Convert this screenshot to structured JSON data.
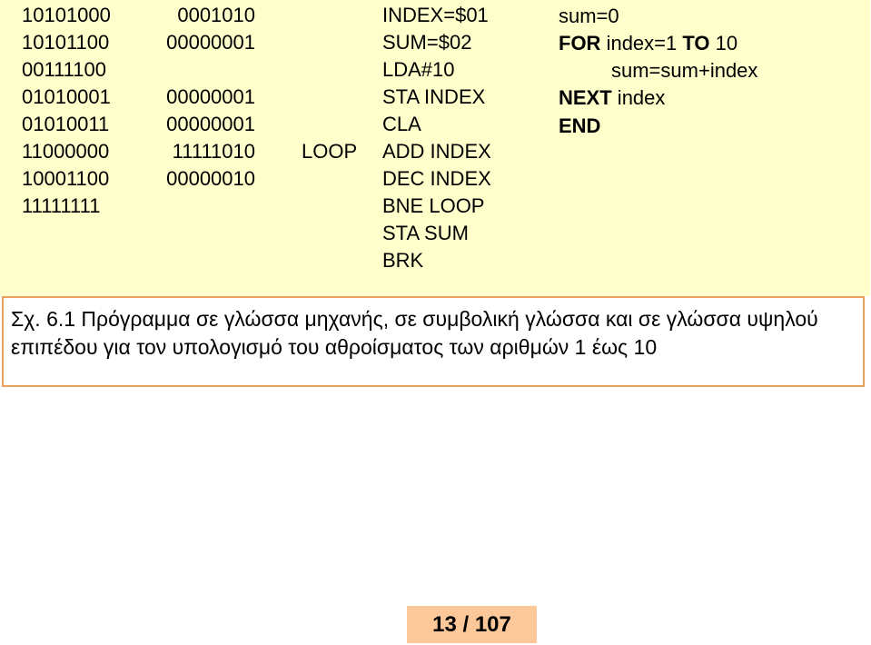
{
  "program_rows": [
    {
      "machine1": "10101000",
      "machine2": "0001010",
      "label": "",
      "asm": "INDEX=$01"
    },
    {
      "machine1": "10101100",
      "machine2": "00000001",
      "label": "",
      "asm": "SUM=$02"
    },
    {
      "machine1": "00111100",
      "machine2": "",
      "label": "",
      "asm": "LDA#10"
    },
    {
      "machine1": "01010001",
      "machine2": "00000001",
      "label": "",
      "asm": "STA INDEX"
    },
    {
      "machine1": "01010011",
      "machine2": "00000001",
      "label": "",
      "asm": "CLA"
    },
    {
      "machine1": "11000000",
      "machine2": "11111010",
      "label": "LOOP",
      "asm": "ADD INDEX"
    },
    {
      "machine1": "10001100",
      "machine2": "00000010",
      "label": "",
      "asm": "DEC INDEX"
    },
    {
      "machine1": "11111111",
      "machine2": "",
      "label": "",
      "asm": "BNE LOOP"
    },
    {
      "machine1": "",
      "machine2": "",
      "label": "",
      "asm": "STA SUM"
    },
    {
      "machine1": "",
      "machine2": "",
      "label": "",
      "asm": "BRK"
    }
  ],
  "high_level": {
    "line1": "sum=0",
    "line2_kw1": "FOR",
    "line2_text1": " index=1 ",
    "line2_kw2": "TO",
    "line2_text2": " 10",
    "line3": "sum=sum+index",
    "line4_kw": "NEXT",
    "line4_text": " index",
    "line5_kw": "END"
  },
  "caption": "Σχ. 6.1   Πρόγραμμα σε γλώσσα μηχανής, σε συμβολική γλώσσα και σε γλώσσα υψηλού επιπέδου για τον υπολογισμό του αθροίσματος των αριθμών 1 έως 10",
  "pager": "13 / 107",
  "colors": {
    "panel": "#FFFFCC",
    "caption_border": "#E8A060",
    "pager_bg": "#FCC89A"
  }
}
